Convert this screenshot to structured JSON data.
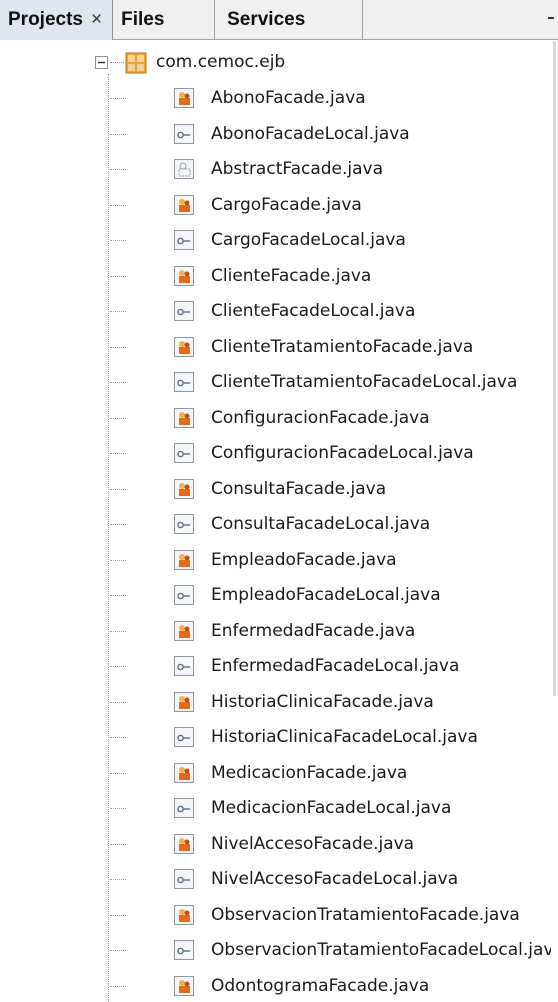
{
  "tabs": [
    {
      "label": "Projects",
      "close": "×",
      "active": true
    },
    {
      "label": "Files"
    },
    {
      "label": "Services"
    }
  ],
  "package": {
    "label": "com.cemoc.ejb",
    "expander": "−"
  },
  "files": [
    {
      "label": "AbonoFacade.java",
      "kind": "bean"
    },
    {
      "label": "AbonoFacadeLocal.java",
      "kind": "interface"
    },
    {
      "label": "AbstractFacade.java",
      "kind": "abstract"
    },
    {
      "label": "CargoFacade.java",
      "kind": "bean"
    },
    {
      "label": "CargoFacadeLocal.java",
      "kind": "interface"
    },
    {
      "label": "ClienteFacade.java",
      "kind": "bean"
    },
    {
      "label": "ClienteFacadeLocal.java",
      "kind": "interface"
    },
    {
      "label": "ClienteTratamientoFacade.java",
      "kind": "bean"
    },
    {
      "label": "ClienteTratamientoFacadeLocal.java",
      "kind": "interface"
    },
    {
      "label": "ConfiguracionFacade.java",
      "kind": "bean"
    },
    {
      "label": "ConfiguracionFacadeLocal.java",
      "kind": "interface"
    },
    {
      "label": "ConsultaFacade.java",
      "kind": "bean"
    },
    {
      "label": "ConsultaFacadeLocal.java",
      "kind": "interface"
    },
    {
      "label": "EmpleadoFacade.java",
      "kind": "bean"
    },
    {
      "label": "EmpleadoFacadeLocal.java",
      "kind": "interface"
    },
    {
      "label": "EnfermedadFacade.java",
      "kind": "bean"
    },
    {
      "label": "EnfermedadFacadeLocal.java",
      "kind": "interface"
    },
    {
      "label": "HistoriaClinicaFacade.java",
      "kind": "bean"
    },
    {
      "label": "HistoriaClinicaFacadeLocal.java",
      "kind": "interface"
    },
    {
      "label": "MedicacionFacade.java",
      "kind": "bean"
    },
    {
      "label": "MedicacionFacadeLocal.java",
      "kind": "interface"
    },
    {
      "label": "NivelAccesoFacade.java",
      "kind": "bean"
    },
    {
      "label": "NivelAccesoFacadeLocal.java",
      "kind": "interface"
    },
    {
      "label": "ObservacionTratamientoFacade.java",
      "kind": "bean"
    },
    {
      "label": "ObservacionTratamientoFacadeLocal.java",
      "kind": "interface"
    },
    {
      "label": "OdontogramaFacade.java",
      "kind": "bean"
    }
  ],
  "colors": {
    "tab_active_bg": "#dfe6f0",
    "tab_bg": "#f0f0f0",
    "package_icon": "#e8a33a",
    "bean_icon_accent": "#e06a1f",
    "interface_icon": "#5a6f8a",
    "tree_lines": "#a0a0a0"
  }
}
